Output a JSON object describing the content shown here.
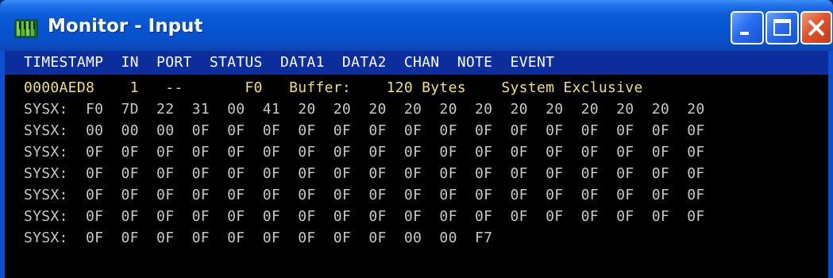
{
  "window": {
    "title": "Monitor - Input",
    "icon": "midi-monitor-icon",
    "controls": [
      "minimize-icon",
      "maximize-icon",
      "close-icon"
    ]
  },
  "colors": {
    "titlebar": "#0453d0",
    "header_bar": "#0b2e9c",
    "background": "#000000",
    "event_text": "#f0e070",
    "sysx_text": "#c8c8c8"
  },
  "header": {
    "text": "TIMESTAMP  IN  PORT  STATUS  DATA1  DATA2  CHAN  NOTE  EVENT"
  },
  "event_row": {
    "text": "0000AED8    1   --       F0   Buffer:    120 Bytes    System Exclusive"
  },
  "sysx_rows": [
    "SYSX:  F0  7D  22  31  00  41  20  20  20  20  20  20  20  20  20  20  20  20",
    "SYSX:  00  00  00  0F  0F  0F  0F  0F  0F  0F  0F  0F  0F  0F  0F  0F  0F  0F",
    "SYSX:  0F  0F  0F  0F  0F  0F  0F  0F  0F  0F  0F  0F  0F  0F  0F  0F  0F  0F",
    "SYSX:  0F  0F  0F  0F  0F  0F  0F  0F  0F  0F  0F  0F  0F  0F  0F  0F  0F  0F",
    "SYSX:  0F  0F  0F  0F  0F  0F  0F  0F  0F  0F  0F  0F  0F  0F  0F  0F  0F  0F",
    "SYSX:  0F  0F  0F  0F  0F  0F  0F  0F  0F  0F  0F  0F  0F  0F  0F  0F  0F  0F",
    "SYSX:  0F  0F  0F  0F  0F  0F  0F  0F  0F  00  00  F7"
  ]
}
